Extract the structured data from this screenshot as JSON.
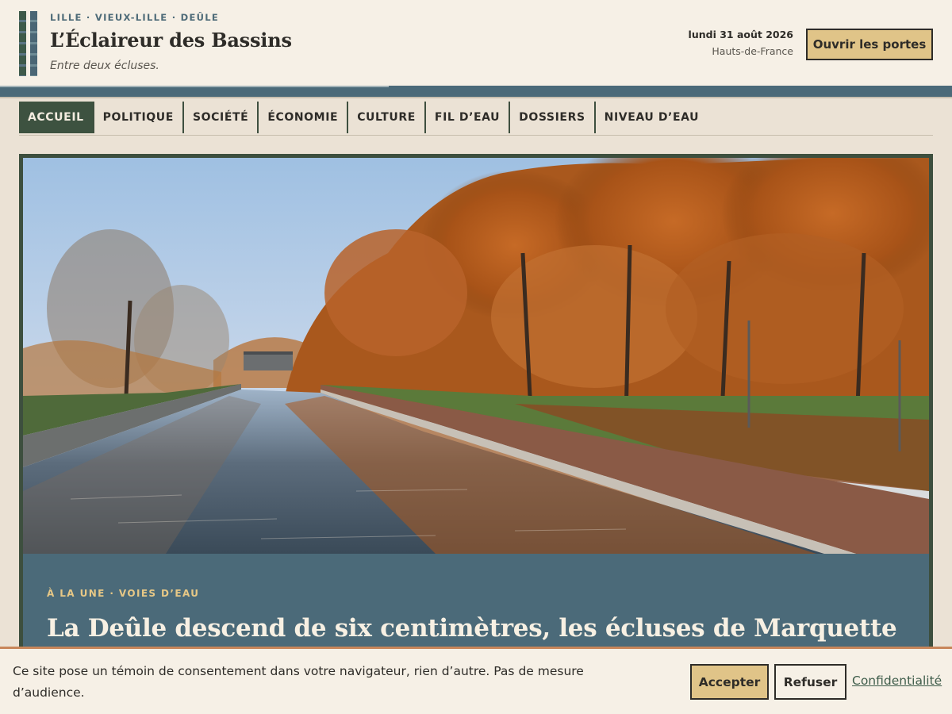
{
  "header": {
    "kicker": "LILLE · VIEUX-LILLE · DEÛLE",
    "title": "L’Éclaireur des Bassins",
    "tagline": "Entre deux écluses.",
    "date": "lundi 31 août 2026",
    "region": "Hauts-de-France",
    "cta_label": "Ouvrir les portes"
  },
  "nav": {
    "items": [
      {
        "label": "ACCUEIL",
        "active": true
      },
      {
        "label": "POLITIQUE"
      },
      {
        "label": "SOCIÉTÉ"
      },
      {
        "label": "ÉCONOMIE"
      },
      {
        "label": "CULTURE"
      },
      {
        "label": "FIL D’EAU"
      },
      {
        "label": "DOSSIERS"
      },
      {
        "label": "NIVEAU D’EAU"
      }
    ]
  },
  "hero": {
    "kicker": "À LA UNE · VOIES D’EAU",
    "headline": "La Deûle descend de six centimètres, les écluses de Marquette"
  },
  "consent": {
    "text": "Ce site pose un témoin de consentement dans votre navigateur, rien d’autre. Pas de mesure d’audience.",
    "accept_label": "Accepter",
    "refuse_label": "Refuser",
    "privacy_label": "Confidentialité"
  },
  "colors": {
    "forest": "#3d5240",
    "slate": "#4b6a79",
    "paper": "#f6f0e6",
    "gold": "#e0c488",
    "rust": "#c8865a"
  }
}
